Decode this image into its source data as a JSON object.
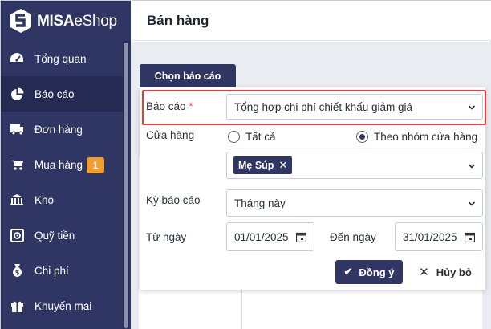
{
  "app": {
    "brand_bold": "MISA",
    "brand_light": "eShop"
  },
  "header": {
    "title": "Bán hàng"
  },
  "sidebar": {
    "items": [
      {
        "label": "Tổng quan",
        "icon": "dashboard-icon"
      },
      {
        "label": "Báo cáo",
        "icon": "pie-chart-icon",
        "active": true
      },
      {
        "label": "Đơn hàng",
        "icon": "order-icon"
      },
      {
        "label": "Mua hàng",
        "icon": "cart-icon",
        "badge": "1"
      },
      {
        "label": "Kho",
        "icon": "warehouse-icon"
      },
      {
        "label": "Quỹ tiền",
        "icon": "safe-icon"
      },
      {
        "label": "Chi phí",
        "icon": "money-bag-icon"
      },
      {
        "label": "Khuyến mại",
        "icon": "gift-icon"
      }
    ]
  },
  "dialog": {
    "tab": "Chọn báo cáo",
    "report_label": "Báo cáo",
    "report_required": "*",
    "report_value": "Tổng hợp chi phí chiết khấu giảm giá",
    "store_label": "Cửa hàng",
    "store_all": "Tất cả",
    "store_group": "Theo nhóm cửa hàng",
    "store_group_selected": true,
    "store_tag": "Mẹ Súp",
    "period_label": "Kỳ báo cáo",
    "period_value": "Tháng này",
    "from_label": "Từ ngày",
    "from_value": "01/01/2025",
    "to_label": "Đến ngày",
    "to_value": "31/01/2025",
    "ok_label": "Đồng ý",
    "cancel_label": "Hủy bỏ"
  },
  "colors": {
    "sidebar": "#2f3663",
    "accent": "#2f3663",
    "badge": "#f39c2f",
    "highlight": "#e63d3d"
  }
}
